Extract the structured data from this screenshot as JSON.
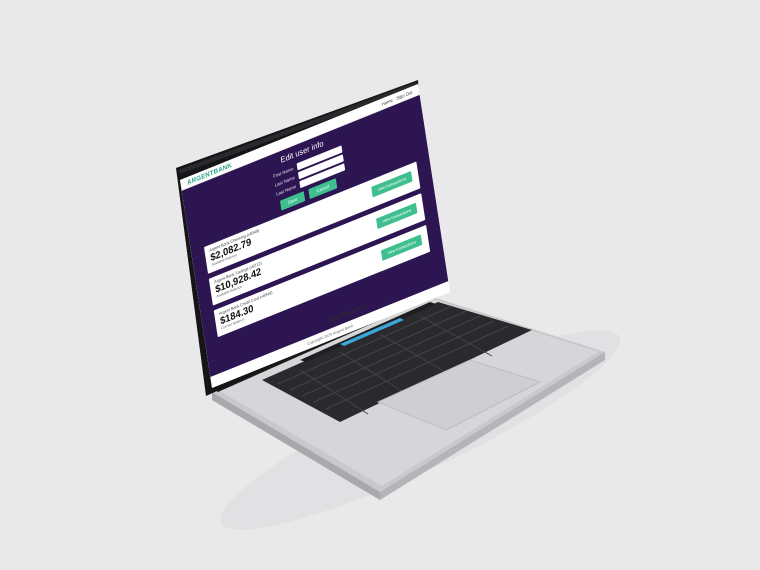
{
  "header": {
    "brand_part1": "ARGENT",
    "brand_part2": "BANK",
    "links": [
      "Home",
      "Sign Out"
    ]
  },
  "form": {
    "title": "Edit user info",
    "fields": [
      {
        "label": "First Name",
        "value": ""
      },
      {
        "label": "Last Name",
        "value": ""
      },
      {
        "label": "Last Name",
        "value": ""
      }
    ],
    "buttons": {
      "save": "Save",
      "cancel": "Cancel"
    }
  },
  "accounts": [
    {
      "name": "Argent Bank Checking (x8349)",
      "amount": "$2,082.79",
      "sub": "Available Balance",
      "button": "View transactions"
    },
    {
      "name": "Argent Bank Savings (x6712)",
      "amount": "$10,928.42",
      "sub": "Available Balance",
      "button": "View transactions"
    },
    {
      "name": "Argent Bank Credit Card (x8349)",
      "amount": "$184.30",
      "sub": "Current Balance",
      "button": "View transactions"
    }
  ],
  "footer": {
    "text": "Copyright 2020 Argent Bank"
  },
  "device": {
    "model": "MacBook Pro"
  }
}
